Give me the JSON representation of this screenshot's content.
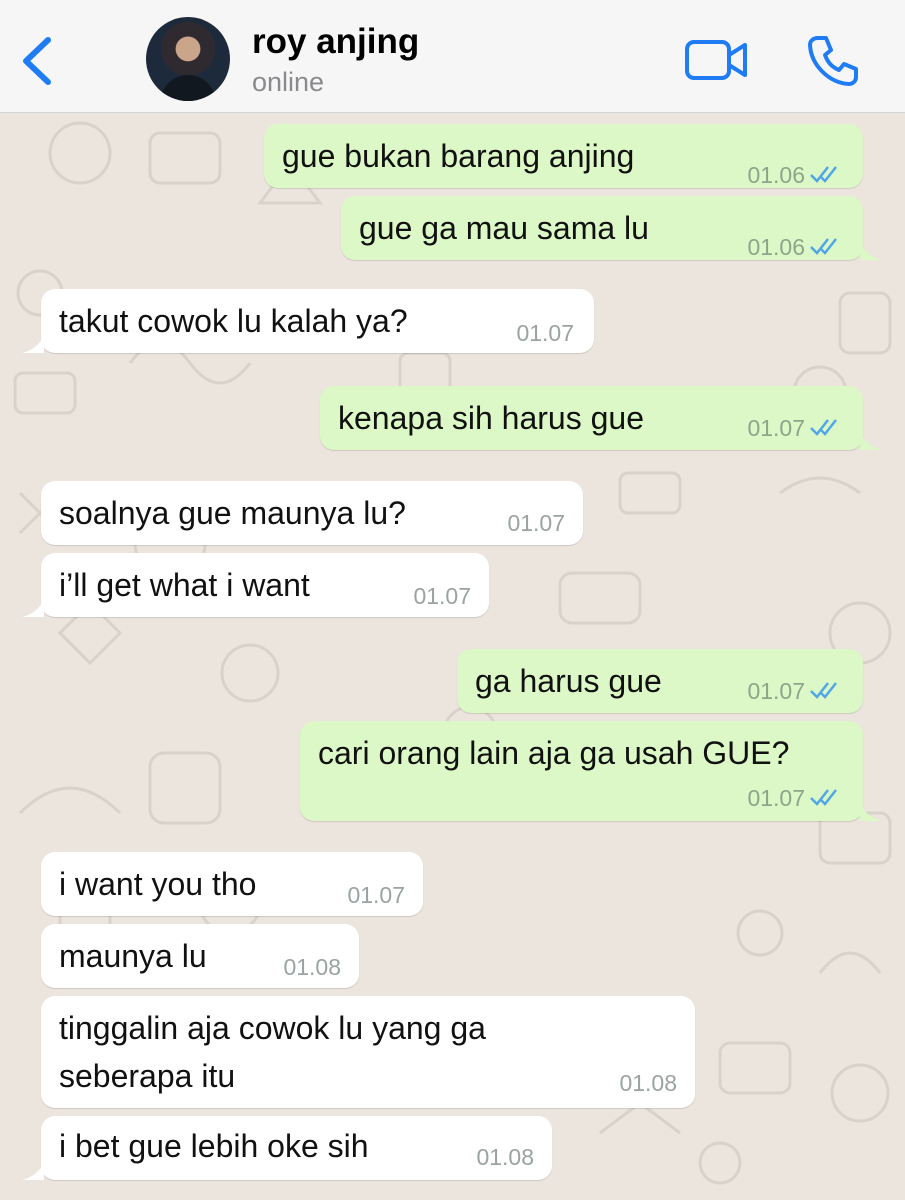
{
  "header": {
    "contact_name": "roy anjing",
    "status": "online"
  },
  "messages": [
    {
      "dir": "out",
      "text": "gue bukan barang anjing",
      "time": "01.06",
      "read": true
    },
    {
      "dir": "out",
      "text": "gue ga mau sama lu",
      "time": "01.06",
      "read": true
    },
    {
      "dir": "in",
      "text": "takut cowok lu kalah ya?",
      "time": "01.07"
    },
    {
      "dir": "out",
      "text": "kenapa sih harus gue",
      "time": "01.07",
      "read": true
    },
    {
      "dir": "in",
      "text": "soalnya gue maunya lu?",
      "time": "01.07"
    },
    {
      "dir": "in",
      "text": "i’ll get what i want",
      "time": "01.07"
    },
    {
      "dir": "out",
      "text": "ga harus gue",
      "time": "01.07",
      "read": true
    },
    {
      "dir": "out",
      "text": "cari orang lain aja ga usah GUE?",
      "time": "01.07",
      "read": true
    },
    {
      "dir": "in",
      "text": "i want you tho",
      "time": "01.07"
    },
    {
      "dir": "in",
      "text": "maunya lu",
      "time": "01.08"
    },
    {
      "dir": "in",
      "text_line1": "tinggalin aja cowok lu yang ga",
      "text_line2": "seberapa itu",
      "time": "01.08"
    },
    {
      "dir": "in",
      "text": "i bet gue lebih oke sih",
      "time": "01.08"
    }
  ],
  "icons": {
    "back": "chevron-left-icon",
    "video": "video-camera-icon",
    "call": "phone-icon",
    "read_receipt": "double-check-icon"
  },
  "colors": {
    "accent": "#1f7cf5",
    "outgoing_bubble": "#dcf8c6",
    "incoming_bubble": "#ffffff",
    "chat_background": "#ece5dd",
    "read_tick": "#4fa7e8"
  }
}
